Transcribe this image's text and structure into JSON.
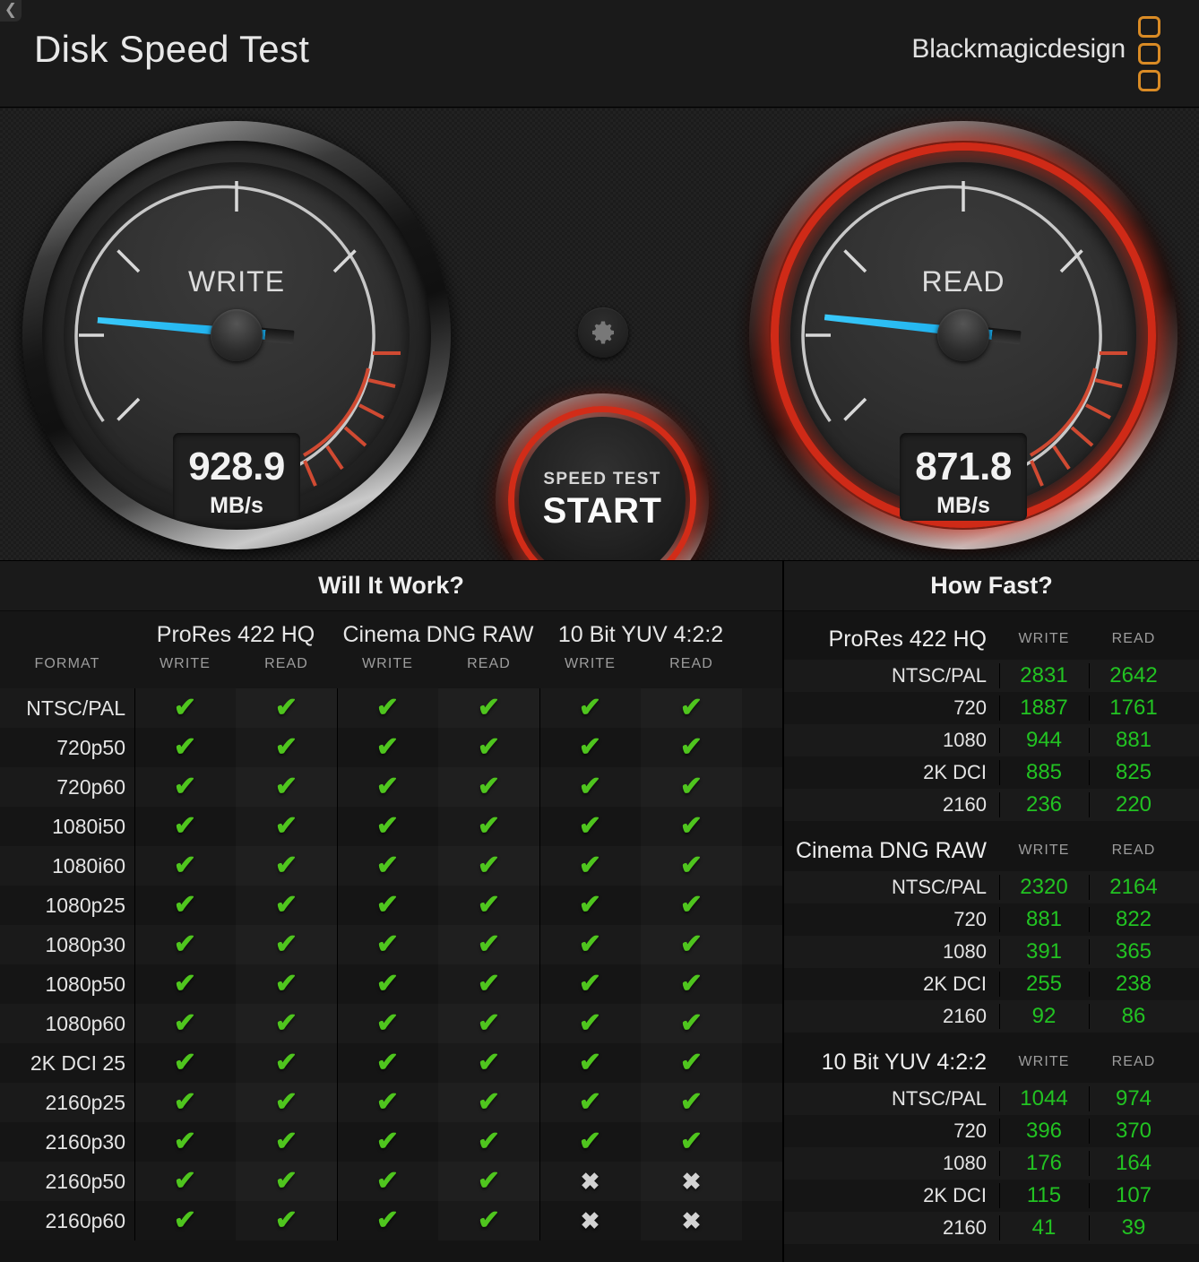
{
  "header": {
    "title": "Disk Speed Test",
    "brand": "Blackmagicdesign",
    "back_icon": "chevron-left-icon"
  },
  "gauges": {
    "write": {
      "label": "WRITE",
      "value": "928.9",
      "unit": "MB/s",
      "needle_color": "#2ec0f5",
      "active": false
    },
    "read": {
      "label": "READ",
      "value": "871.8",
      "unit": "MB/s",
      "needle_color": "#2ec0f5",
      "active": true,
      "glow_color": "#cf2a17"
    }
  },
  "start_button": {
    "line1": "SPEED TEST",
    "line2": "START",
    "glow_color": "#d22c18"
  },
  "settings_button": {
    "icon": "gear-icon"
  },
  "will_it_work": {
    "title": "Will It Work?",
    "format_header": "FORMAT",
    "groups": [
      "ProRes 422 HQ",
      "Cinema DNG RAW",
      "10 Bit YUV 4:2:2"
    ],
    "sub_headers": [
      "WRITE",
      "READ",
      "WRITE",
      "READ",
      "WRITE",
      "READ"
    ],
    "pass_glyph": "✔",
    "fail_glyph": "✖",
    "pass_color": "#4fc51e",
    "fail_color": "#d2d2d2",
    "rows": [
      {
        "format": "NTSC/PAL",
        "cells": [
          true,
          true,
          true,
          true,
          true,
          true
        ]
      },
      {
        "format": "720p50",
        "cells": [
          true,
          true,
          true,
          true,
          true,
          true
        ]
      },
      {
        "format": "720p60",
        "cells": [
          true,
          true,
          true,
          true,
          true,
          true
        ]
      },
      {
        "format": "1080i50",
        "cells": [
          true,
          true,
          true,
          true,
          true,
          true
        ]
      },
      {
        "format": "1080i60",
        "cells": [
          true,
          true,
          true,
          true,
          true,
          true
        ]
      },
      {
        "format": "1080p25",
        "cells": [
          true,
          true,
          true,
          true,
          true,
          true
        ]
      },
      {
        "format": "1080p30",
        "cells": [
          true,
          true,
          true,
          true,
          true,
          true
        ]
      },
      {
        "format": "1080p50",
        "cells": [
          true,
          true,
          true,
          true,
          true,
          true
        ]
      },
      {
        "format": "1080p60",
        "cells": [
          true,
          true,
          true,
          true,
          true,
          true
        ]
      },
      {
        "format": "2K DCI 25",
        "cells": [
          true,
          true,
          true,
          true,
          true,
          true
        ]
      },
      {
        "format": "2160p25",
        "cells": [
          true,
          true,
          true,
          true,
          true,
          true
        ]
      },
      {
        "format": "2160p30",
        "cells": [
          true,
          true,
          true,
          true,
          true,
          true
        ]
      },
      {
        "format": "2160p50",
        "cells": [
          true,
          true,
          true,
          true,
          false,
          false
        ]
      },
      {
        "format": "2160p60",
        "cells": [
          true,
          true,
          true,
          true,
          false,
          false
        ]
      }
    ]
  },
  "how_fast": {
    "title": "How Fast?",
    "col_write": "WRITE",
    "col_read": "READ",
    "value_color": "#22c322",
    "groups": [
      {
        "name": "ProRes 422 HQ",
        "rows": [
          {
            "label": "NTSC/PAL",
            "write": "2831",
            "read": "2642"
          },
          {
            "label": "720",
            "write": "1887",
            "read": "1761"
          },
          {
            "label": "1080",
            "write": "944",
            "read": "881"
          },
          {
            "label": "2K DCI",
            "write": "885",
            "read": "825"
          },
          {
            "label": "2160",
            "write": "236",
            "read": "220"
          }
        ]
      },
      {
        "name": "Cinema DNG RAW",
        "rows": [
          {
            "label": "NTSC/PAL",
            "write": "2320",
            "read": "2164"
          },
          {
            "label": "720",
            "write": "881",
            "read": "822"
          },
          {
            "label": "1080",
            "write": "391",
            "read": "365"
          },
          {
            "label": "2K DCI",
            "write": "255",
            "read": "238"
          },
          {
            "label": "2160",
            "write": "92",
            "read": "86"
          }
        ]
      },
      {
        "name": "10 Bit YUV 4:2:2",
        "rows": [
          {
            "label": "NTSC/PAL",
            "write": "1044",
            "read": "974"
          },
          {
            "label": "720",
            "write": "396",
            "read": "370"
          },
          {
            "label": "1080",
            "write": "176",
            "read": "164"
          },
          {
            "label": "2K DCI",
            "write": "115",
            "read": "107"
          },
          {
            "label": "2160",
            "write": "41",
            "read": "39"
          }
        ]
      }
    ]
  },
  "chart_data": {
    "type": "table",
    "title": "Blackmagic Disk Speed Test results",
    "gauge_readings": {
      "write_mbps": 928.9,
      "read_mbps": 871.8,
      "unit": "MB/s"
    },
    "how_fast_frames_per_second": {
      "columns": [
        "WRITE",
        "READ"
      ],
      "rows_labels": [
        "NTSC/PAL",
        "720",
        "1080",
        "2K DCI",
        "2160"
      ],
      "series": [
        {
          "name": "ProRes 422 HQ",
          "write": [
            2831,
            1887,
            944,
            885,
            236
          ],
          "read": [
            2642,
            1761,
            881,
            825,
            220
          ]
        },
        {
          "name": "Cinema DNG RAW",
          "write": [
            2320,
            881,
            391,
            255,
            92
          ],
          "read": [
            2164,
            822,
            365,
            238,
            86
          ]
        },
        {
          "name": "10 Bit YUV 4:2:2",
          "write": [
            1044,
            396,
            176,
            115,
            41
          ],
          "read": [
            974,
            370,
            164,
            107,
            39
          ]
        }
      ]
    },
    "will_it_work_matrix": {
      "columns": [
        "ProRes 422 HQ WRITE",
        "ProRes 422 HQ READ",
        "Cinema DNG RAW WRITE",
        "Cinema DNG RAW READ",
        "10 Bit YUV 4:2:2 WRITE",
        "10 Bit YUV 4:2:2 READ"
      ],
      "rows": [
        "NTSC/PAL",
        "720p50",
        "720p60",
        "1080i50",
        "1080i60",
        "1080p25",
        "1080p30",
        "1080p50",
        "1080p60",
        "2K DCI 25",
        "2160p25",
        "2160p30",
        "2160p50",
        "2160p60"
      ],
      "values": [
        [
          1,
          1,
          1,
          1,
          1,
          1
        ],
        [
          1,
          1,
          1,
          1,
          1,
          1
        ],
        [
          1,
          1,
          1,
          1,
          1,
          1
        ],
        [
          1,
          1,
          1,
          1,
          1,
          1
        ],
        [
          1,
          1,
          1,
          1,
          1,
          1
        ],
        [
          1,
          1,
          1,
          1,
          1,
          1
        ],
        [
          1,
          1,
          1,
          1,
          1,
          1
        ],
        [
          1,
          1,
          1,
          1,
          1,
          1
        ],
        [
          1,
          1,
          1,
          1,
          1,
          1
        ],
        [
          1,
          1,
          1,
          1,
          1,
          1
        ],
        [
          1,
          1,
          1,
          1,
          1,
          1
        ],
        [
          1,
          1,
          1,
          1,
          1,
          1
        ],
        [
          1,
          1,
          1,
          1,
          0,
          0
        ],
        [
          1,
          1,
          1,
          1,
          0,
          0
        ]
      ]
    }
  }
}
